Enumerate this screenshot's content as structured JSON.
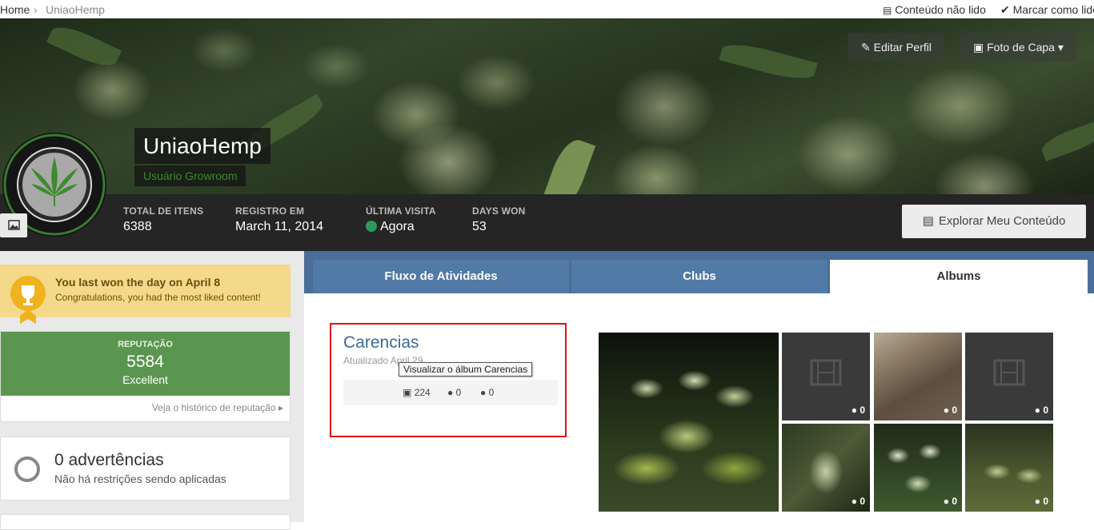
{
  "topbar": {
    "home": "Home",
    "current": "UniaoHemp",
    "unread_label": "Conteúdo não lido",
    "mark_read_label": "Marcar como lido"
  },
  "cover": {
    "edit_profile_label": "Editar Perfil",
    "cover_photo_label": "Foto de Capa"
  },
  "profile": {
    "name": "UniaoHemp",
    "group": "Usuário Growroom",
    "logo_text": "CANNABIS"
  },
  "stats": {
    "items": [
      {
        "label": "TOTAL DE ITENS",
        "value": "6388"
      },
      {
        "label": "REGISTRO EM",
        "value": "March 11, 2014"
      },
      {
        "label": "ÚLTIMA VISITA",
        "value": "Agora"
      },
      {
        "label": "DAYS WON",
        "value": "53"
      }
    ],
    "explore_label": "Explorar Meu Conteúdo"
  },
  "sidebar": {
    "trophy_title": "You last won the day on April 8",
    "trophy_sub": "Congratulations, you had the most liked content!",
    "rep_label": "REPUTAÇÃO",
    "rep_value": "5584",
    "rep_level": "Excellent",
    "rep_history": "Veja o histórico de reputação",
    "warn_title": "0 advertências",
    "warn_sub": "Não há restrições sendo aplicadas"
  },
  "tabs": [
    {
      "label": "Fluxo de Atividades"
    },
    {
      "label": "Clubs"
    },
    {
      "label": "Albums"
    }
  ],
  "album": {
    "title": "Carencias",
    "updated": "Atualizado April 29",
    "tooltip": "Visualizar o álbum Carencias",
    "images": "224",
    "comments_a": "0",
    "comments_b": "0"
  },
  "thumbs": [
    {
      "comments": "0"
    },
    {
      "comments": "0"
    },
    {
      "comments": "0"
    },
    {
      "comments": "0"
    },
    {
      "comments": "0"
    },
    {
      "comments": "0"
    }
  ],
  "colors": {
    "tab_bar": "#4a6e98",
    "reputation_green": "#5b9651",
    "trophy_yellow": "#f5d98a",
    "highlight_red": "#dd1111",
    "online_dot": "#2b9a5a"
  }
}
